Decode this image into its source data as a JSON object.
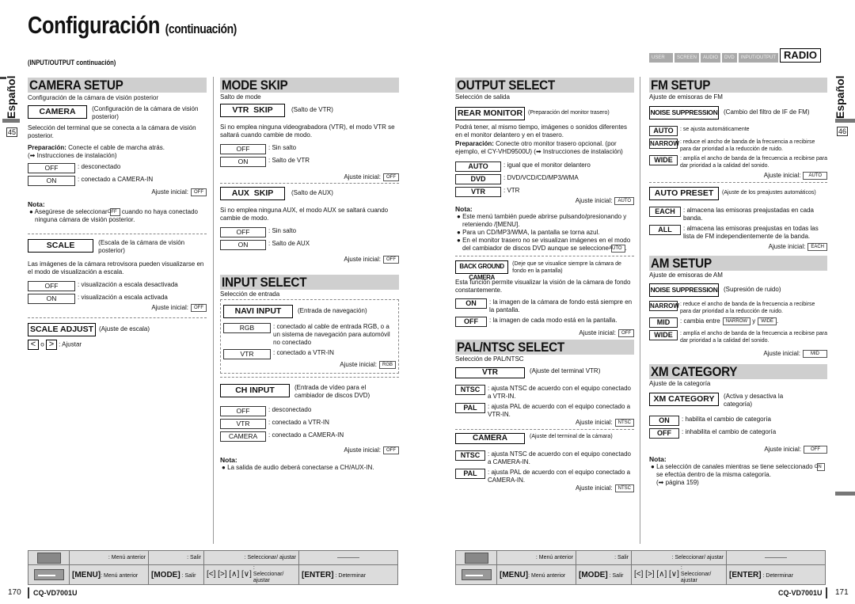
{
  "header": {
    "title": "Configuración",
    "title_sub": "(continuación)",
    "subheading": "(INPUT/OUTPUT continuación)"
  },
  "side": {
    "left_language": "Español",
    "left_page_index": "45",
    "right_language": "Español",
    "right_page_index": "46"
  },
  "tabs": {
    "items": [
      "USER",
      "SCREEN",
      "AUDIO",
      "DVD",
      "INPUT/OUTPUT"
    ],
    "active": "RADIO"
  },
  "camera_setup": {
    "heading": "CAMERA SETUP",
    "intro": "Configuración de la cámara de visión posterior",
    "camera_button": "CAMERA",
    "camera_desc": "(Configuración de la cámara de visión posterior)",
    "camera_text": "Selección del terminal que se conecta a la cámara de visión posterior.",
    "prep_label": "Preparación:",
    "prep_text": " Conecte el cable de marcha atrás.",
    "prep_ref": "(➡ Instrucciones de instalación)",
    "camera_options": [
      {
        "label": "OFF",
        "desc": ": desconectado"
      },
      {
        "label": "ON",
        "desc": ": conectado a CAMERA-IN"
      }
    ],
    "camera_initial_label": "Ajuste inicial:",
    "camera_initial": "OFF",
    "note_title": "Nota:",
    "note_pre": "Asegúrese de seleccionar",
    "note_chip": "OFF",
    "note_post": "cuando no haya conectado ninguna cámara de visión posterior.",
    "scale_button": "SCALE",
    "scale_desc": "(Escala de la cámara de visión posterior)",
    "scale_text": "Las imágenes de la cámara retrovisora pueden visualizarse en el modo de visualización a escala.",
    "scale_options": [
      {
        "label": "OFF",
        "desc": ": visualización a escala desactivada"
      },
      {
        "label": "ON",
        "desc": ": visualización a escala activada"
      }
    ],
    "scale_initial_label": "Ajuste inicial:",
    "scale_initial": "OFF",
    "scale_adjust_button": "SCALE ADJUST",
    "scale_adjust_desc": "(Ajuste de escala)",
    "adjust_left": "<",
    "adjust_or": "o",
    "adjust_right": ">",
    "adjust_text": ": Ajustar"
  },
  "mode_skip": {
    "heading": "MODE SKIP",
    "intro": "Salto de mode",
    "vtr_button": "VTR  SKIP",
    "vtr_desc": "(Salto de VTR)",
    "vtr_text": "Si no emplea ninguna videograbadora (VTR), el modo VTR se saltará cuando cambie de modo.",
    "vtr_options": [
      {
        "label": "OFF",
        "desc": ": Sin salto"
      },
      {
        "label": "ON",
        "desc": ": Salto de VTR"
      }
    ],
    "vtr_initial_label": "Ajuste inicial:",
    "vtr_initial": "OFF",
    "aux_button": "AUX  SKIP",
    "aux_desc": "(Salto de AUX)",
    "aux_text": "Si no emplea ninguna AUX, el modo AUX se saltará cuando cambie de modo.",
    "aux_options": [
      {
        "label": "OFF",
        "desc": ": Sin salto"
      },
      {
        "label": "ON",
        "desc": ": Salto de AUX"
      }
    ],
    "aux_initial_label": "Ajuste inicial:",
    "aux_initial": "OFF"
  },
  "input_select": {
    "heading": "INPUT SELECT",
    "intro": "Selección de entrada",
    "navi_button": "NAVI INPUT",
    "navi_desc": "(Entrada de navegación)",
    "navi_options": [
      {
        "label": "RGB",
        "desc": ": conectado al cable de entrada RGB, o a un sistema de navegación para automóvil no conectado"
      },
      {
        "label": "VTR",
        "desc": ": conectado a VTR-IN"
      }
    ],
    "navi_initial_label": "Ajuste inicial:",
    "navi_initial": "RGB",
    "ch_button": "CH INPUT",
    "ch_desc": "(Entrada de vídeo para el cambiador de discos DVD)",
    "ch_options": [
      {
        "label": "OFF",
        "desc": ": desconectado"
      },
      {
        "label": "VTR",
        "desc": ": conectado a VTR-IN"
      },
      {
        "label": "CAMERA",
        "desc": ": conectado a CAMERA-IN"
      }
    ],
    "ch_initial_label": "Ajuste inicial:",
    "ch_initial": "OFF",
    "note_title": "Nota:",
    "note": "La salida de audio deberá conectarse a CH/AUX-IN."
  },
  "output_select": {
    "heading": "OUTPUT SELECT",
    "intro": "Selección de salida",
    "rear_button": "REAR MONITOR",
    "rear_desc": "(Preparación del monitor trasero)",
    "rear_text": "Podrá tener, al mismo tiempo, imágenes o sonidos diferentes en el monitor delantero y en el trasero.",
    "prep_label": "Preparación:",
    "prep_text": " Conecte otro monitor trasero opcional. (por ejemplo, el CY-VHD9500U)  (➡ Instrucciones de instalación)",
    "rear_options": [
      {
        "label": "AUTO",
        "desc": ": igual que el monitor delantero"
      },
      {
        "label": "DVD",
        "desc": ": DVD/VCD/CD/MP3/WMA"
      },
      {
        "label": "VTR",
        "desc": ": VTR"
      }
    ],
    "rear_initial_label": "Ajuste inicial:",
    "rear_initial": "AUTO",
    "note_title": "Nota:",
    "notes": [
      "Este menú también puede abrirse pulsando/presionando y reteniendo        /[MENU].",
      "Para un CD/MP3/WMA, la pantalla se torna azul.",
      "En el monitor trasero no se visualizan imágenes en el modo del cambiador de discos DVD aunque se seleccione"
    ],
    "note3_chip": "AUTO",
    "bg_button": "BACK GROUND CAMERA",
    "bg_desc": "(Deje que se visualice siempre la cámara de fondo en la pantalla)",
    "bg_text": "Esta función permite visualizar la visión de la cámara de fondo constantemente.",
    "bg_options": [
      {
        "label": "ON",
        "desc": ": la imagen de la cámara de fondo está siempre en la pantalla."
      },
      {
        "label": "OFF",
        "desc": ": la imagen de cada modo está en la pantalla."
      }
    ],
    "bg_initial_label": "Ajuste inicial:",
    "bg_initial": "OFF"
  },
  "pal_ntsc": {
    "heading": "PAL/NTSC SELECT",
    "intro": "Selección de PAL/NTSC",
    "vtr_button": "VTR",
    "vtr_desc": "(Ajuste del terminal VTR)",
    "vtr_options": [
      {
        "label": "NTSC",
        "desc": ": ajusta NTSC de acuerdo con el equipo conectado a VTR-IN."
      },
      {
        "label": "PAL",
        "desc": ": ajusta PAL de acuerdo con el equipo conectado a VTR-IN."
      }
    ],
    "vtr_initial_label": "Ajuste inicial:",
    "vtr_initial": "NTSC",
    "cam_button": "CAMERA",
    "cam_desc": "(Ajuste del terminal de la cámara)",
    "cam_options": [
      {
        "label": "NTSC",
        "desc": ": ajusta NTSC de acuerdo con el equipo conectado a CAMERA-IN."
      },
      {
        "label": "PAL",
        "desc": ": ajusta PAL de acuerdo con el equipo conectado a CAMERA-IN."
      }
    ],
    "cam_initial_label": "Ajuste inicial:",
    "cam_initial": "NTSC"
  },
  "fm_setup": {
    "heading": "FM SETUP",
    "intro": "Ajuste de emisoras de FM",
    "ns_button": "NOISE SUPPRESSION",
    "ns_desc": "(Cambio del filtro de IF de FM)",
    "ns_options": [
      {
        "label": "AUTO",
        "desc": ": se ajusta automáticamente"
      },
      {
        "label": "NARROW",
        "desc": ": reduce el ancho de banda de la frecuencia a recibirse para dar prioridad a la reducción de ruido."
      },
      {
        "label": "WIDE",
        "desc": ": amplía el ancho de banda de la frecuencia a recibirse para dar prioridad a la calidad del sonido."
      }
    ],
    "ns_initial_label": "Ajuste inicial:",
    "ns_initial": "AUTO",
    "ap_button": "AUTO PRESET",
    "ap_desc": "(Ajuste de los preajustes automáticos)",
    "ap_options": [
      {
        "label": "EACH",
        "desc": ": almacena las emisoras preajustadas en cada banda."
      },
      {
        "label": "ALL",
        "desc": ": almacena las emisoras preajustas en todas las lista de FM independientemente de la banda."
      }
    ],
    "ap_initial_label": "Ajuste inicial:",
    "ap_initial": "EACH"
  },
  "am_setup": {
    "heading": "AM SETUP",
    "intro": "Ajuste de emisoras de AM",
    "ns_button": "NOISE SUPPRESSION",
    "ns_desc": "(Supresión de ruido)",
    "narrow_label": "NARROW",
    "narrow_desc": ": reduce el ancho de banda de la frecuencia a recibirse para dar prioridad a la reducción de ruido.",
    "mid_label": "MID",
    "mid_pre": ": cambia entre",
    "mid_chip1": "NARROW",
    "mid_and": "y",
    "mid_chip2": "WIDE",
    "wide_label": "WIDE",
    "wide_desc": ": amplía el ancho de banda de la frecuencia a recibirse para dar prioridad a la calidad del sonido.",
    "initial_label": "Ajuste inicial:",
    "initial": "MID"
  },
  "xm_category": {
    "heading": "XM CATEGORY",
    "intro": "Ajuste de la categoría",
    "button": "XM CATEGORY",
    "desc": "(Activa y desactiva la categoría)",
    "options": [
      {
        "label": "ON",
        "desc": ": habilita el cambio de categoría"
      },
      {
        "label": "OFF",
        "desc": ": inhabilita el cambio de categoría"
      }
    ],
    "initial_label": "Ajuste inicial:",
    "initial": "OFF",
    "note_title": "Nota:",
    "note_pre": "La selección de canales mientras se tiene seleccionado",
    "note_chip": "ON",
    "note_post": "se efectúa dentro de la misma categoría.",
    "note_ref": "(➡ página 159)"
  },
  "controls": {
    "row1": [
      ": Menú anterior",
      ": Salir",
      ": Seleccionar/ ajustar",
      "————"
    ],
    "row2_keys": [
      "[MENU]",
      "[MODE]",
      "[<] [>] [∧] [∨]",
      "[ENTER]"
    ],
    "row2_desc": [
      ": Menú anterior",
      ": Salir",
      ": Seleccionar/ ajustar",
      ": Determinar"
    ]
  },
  "footer": {
    "left_page": "170",
    "left_model": "CQ-VD7001U",
    "right_page": "171",
    "right_model": "CQ-VD7001U"
  }
}
